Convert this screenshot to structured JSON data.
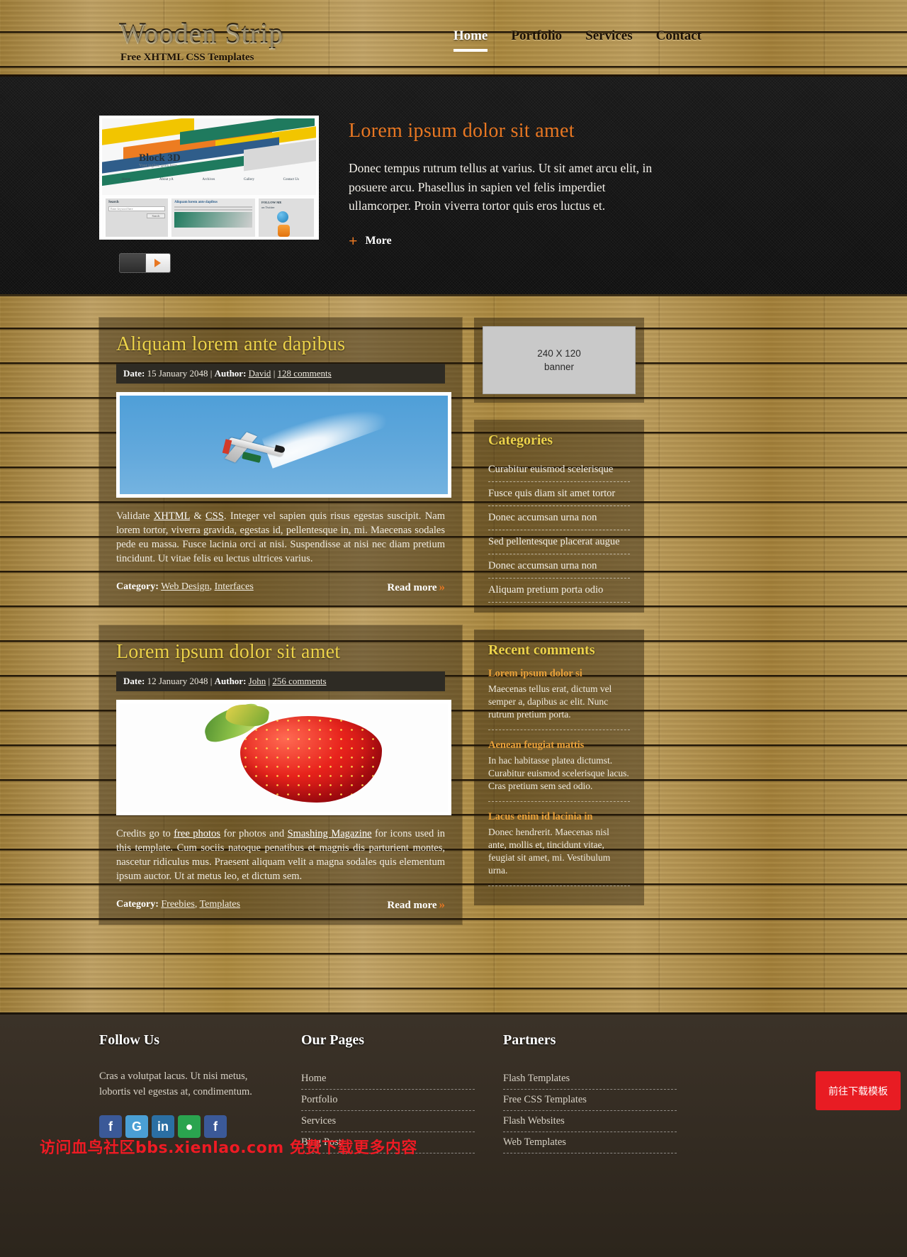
{
  "header": {
    "logo_title": "Wooden Strip",
    "logo_sub": "Free XHTML CSS Templates",
    "nav": [
      {
        "label": "Home",
        "active": true
      },
      {
        "label": "Portfolio",
        "active": false
      },
      {
        "label": "Services",
        "active": false
      },
      {
        "label": "Contact",
        "active": false
      }
    ]
  },
  "banner": {
    "heading": "Lorem ipsum dolor sit amet",
    "paragraph": "Donec tempus rutrum tellus at varius. Ut sit amet arcu elit, in posuere arcu. Phasellus in sapien vel felis imperdiet ullamcorper. Proin viverra tortor quis eros luctus et.",
    "more_label": "More",
    "plus_glyph": "+",
    "shot": {
      "title": "Block 3D",
      "subtitle": "Your tagline goes here",
      "nav": [
        "Home",
        "About yA",
        "Archives",
        "Gallery",
        "Contact Us"
      ],
      "search_label": "Search",
      "search_placeholder": "Enter keyword here",
      "search_button": "Search",
      "column_label": "Aliquam lorem ante dapibus",
      "follow_label": "FOLLOW ME",
      "follow_sub": "on Twitter"
    }
  },
  "posts": [
    {
      "title": "Aliquam lorem ante dapibus",
      "meta_date_label": "Date:",
      "meta_date": "15 January 2048",
      "meta_author_label": "Author:",
      "meta_author": "David",
      "meta_comments": "128 comments",
      "body_lead": "Validate ",
      "link_xhtml": "XHTML",
      "amp": " & ",
      "link_css": "CSS",
      "body_rest": ". Integer vel sapien quis risus egestas suscipit. Nam lorem tortor, viverra gravida, egestas id, pellentesque in, mi. Maecenas sodales pede eu massa. Fusce lacinia orci at nisi. Suspendisse at nisi nec diam pretium tincidunt. Ut vitae felis eu lectus ultrices varius.",
      "category_label": "Category:",
      "categories": [
        "Web Design",
        "Interfaces"
      ],
      "read_more": "Read more",
      "image_kind": "airplane-smoke-trail"
    },
    {
      "title": "Lorem ipsum dolor sit amet",
      "meta_date_label": "Date:",
      "meta_date": "12 January 2048",
      "meta_author_label": "Author:",
      "meta_author": "John",
      "meta_comments": "256 comments",
      "body_lead": "Credits go to ",
      "link_xhtml": "free photos",
      "amp": " for photos and ",
      "link_css": "Smashing Magazine",
      "body_rest": " for icons used in this template. Cum sociis natoque penatibus et magnis dis parturient montes, nascetur ridiculus mus. Praesent aliquam velit a magna sodales quis elementum ipsum auctor. Ut at metus leo, et dictum sem.",
      "category_label": "Category:",
      "categories": [
        "Freebies",
        "Templates"
      ],
      "read_more": "Read more",
      "image_kind": "strawberry"
    }
  ],
  "sidebar": {
    "banner_line1": "240 X 120",
    "banner_line2": "banner",
    "categories_heading": "Categories",
    "categories": [
      "Curabitur euismod scelerisque",
      "Fusce quis diam sit amet tortor",
      "Donec accumsan urna non",
      "Sed pellentesque placerat augue",
      "Donec accumsan urna non",
      "Aliquam pretium porta odio"
    ],
    "comments_heading": "Recent comments",
    "comments": [
      {
        "title": "Lorem ipsum dolor si",
        "text": "Maecenas tellus erat, dictum vel semper a, dapibus ac elit. Nunc rutrum pretium porta."
      },
      {
        "title": "Aenean feugiat mattis",
        "text": "In hac habitasse platea dictumst. Curabitur euismod scelerisque lacus. Cras pretium sem sed odio."
      },
      {
        "title": "Lacus enim id lacinia in",
        "text": "Donec hendrerit. Maecenas nisl ante, mollis et, tincidunt vitae, feugiat sit amet, mi. Vestibulum urna."
      }
    ]
  },
  "footer": {
    "follow_heading": "Follow Us",
    "follow_text": "Cras a volutpat lacus. Ut nisi metus, lobortis vel egestas at, condimentum.",
    "social": [
      {
        "name": "facebook",
        "glyph": "f"
      },
      {
        "name": "google-talk",
        "glyph": "G"
      },
      {
        "name": "linkedin",
        "glyph": "in"
      },
      {
        "name": "wechat",
        "glyph": "●"
      },
      {
        "name": "facebook-alt",
        "glyph": "f"
      }
    ],
    "pages_heading": "Our Pages",
    "pages": [
      "Home",
      "Portfolio",
      "Services",
      "Blog Post"
    ],
    "partners_heading": "Partners",
    "partners": [
      "Flash Templates",
      "Free CSS Templates",
      "Flash Websites",
      "Web Templates"
    ]
  },
  "overlay": {
    "download_button": "前往下载模板",
    "watermark": "访问血鸟社区bbs.xienlao.com 免费下载更多内容"
  },
  "colors": {
    "wood": "#a8873f",
    "accent_orange": "#e87722",
    "accent_yellow": "#ecd24a",
    "dark_panel": "#2e2b24",
    "footer_bg": "#3b3228",
    "download_red": "#e81c23"
  }
}
